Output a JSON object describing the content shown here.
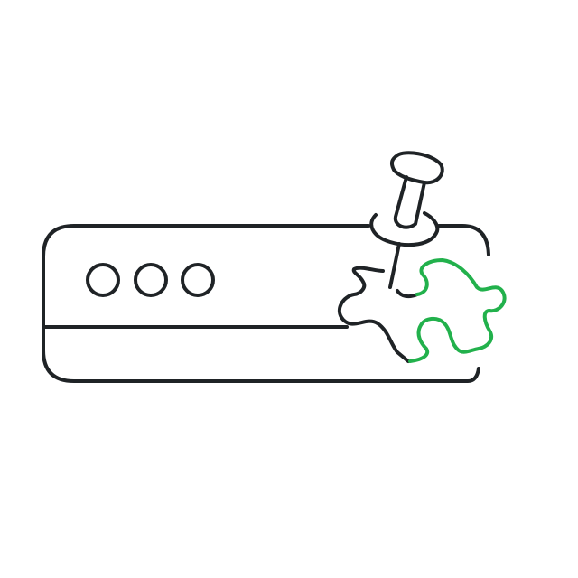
{
  "illustration": {
    "icon": "pinned-browser-extension-icon",
    "colors": {
      "line": "#1f2326",
      "accent": "#22b14c",
      "background": "#ffffff"
    },
    "parts": {
      "browser_window": "browser-window-icon",
      "window_dots": [
        "dot-icon",
        "dot-icon",
        "dot-icon"
      ],
      "puzzle_piece": "puzzle-piece-icon",
      "push_pin": "push-pin-icon"
    }
  }
}
